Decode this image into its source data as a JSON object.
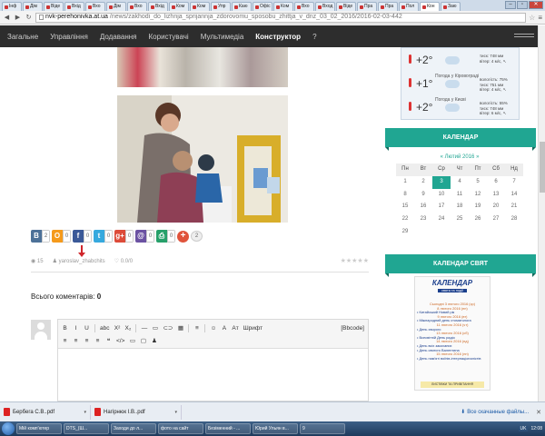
{
  "browser": {
    "tabs": [
      "Інф",
      "Дім",
      "Віде",
      "Вхід",
      "Вхо",
      "Дім",
      "Вхо",
      "Вхід",
      "Ком",
      "Ком",
      "Упр",
      "Каю",
      "Офіс",
      "Ком",
      "Вхо",
      "Вход",
      "Віде",
      "Пра",
      "Пра",
      "Пол",
      "Кон",
      "Заю"
    ],
    "active_tab_index": 20,
    "url_host": "nvk-perehonivka.at.ua",
    "url_path": "/news/zakhodi_do_lizhnja_sprijannja_zdorovomu_sposobu_zhittja_v_dnz_03_02_2016/2016-02-03-442"
  },
  "nav": {
    "items": [
      "Загальне",
      "Управління",
      "Додавання",
      "Користувачі",
      "Мультимедіа",
      "Конструктор",
      "?"
    ],
    "active_index": 5
  },
  "share": {
    "buttons": [
      {
        "icon": "В",
        "count": "2",
        "color": "#4d7198"
      },
      {
        "icon": "O",
        "count": "0",
        "color": "#f59a1b"
      },
      {
        "icon": "f",
        "count": "0",
        "color": "#3b5998"
      },
      {
        "icon": "t",
        "count": "0",
        "color": "#36a9de"
      },
      {
        "icon": "g+",
        "count": "0",
        "color": "#dd4b39"
      },
      {
        "icon": "@",
        "count": "0",
        "color": "#6b52a2"
      },
      {
        "icon": "⎙",
        "count": "0",
        "color": "#27a06a"
      }
    ],
    "plus_count": "2"
  },
  "meta": {
    "views": "15",
    "author": "yaroslav_zhabchits",
    "rating": "0.0/0",
    "stars": "★★★★★"
  },
  "comments": {
    "label": "Всього коментарів: ",
    "count": "0"
  },
  "editor": {
    "row1": [
      "B",
      "I",
      "U",
      "abc",
      "X²",
      "X₂",
      "—",
      "▭",
      "⊂⊃",
      "▦",
      "≡",
      "☺",
      "A",
      "Aᴛ",
      "Шрифт",
      "[Bbcode]"
    ],
    "row2": [
      "≡",
      "≡",
      "≡",
      "≡",
      "❝",
      "</>",
      "▭",
      "▢",
      "♟"
    ]
  },
  "weather": [
    {
      "city": "",
      "temp": "+2°",
      "details": [
        "тиск: 748 мм",
        "вітер: 4 м/с, ↖"
      ]
    },
    {
      "city": "Погода у Кіровограді",
      "temp": "+1°",
      "details": [
        "вологість: 75%",
        "тиск: 751 мм",
        "вітер: 4 м/с, ↖"
      ]
    },
    {
      "city": "Погода у Києві",
      "temp": "+2°",
      "details": [
        "вологість: 55%",
        "тиск: 748 мм",
        "вітер: 6 м/с, ↖"
      ]
    }
  ],
  "calendar": {
    "title": "КАЛЕНДАР",
    "month": "Лютий 2016",
    "prev": "«",
    "next": "»",
    "days": [
      "Пн",
      "Вт",
      "Ср",
      "Чт",
      "Пт",
      "Сб",
      "Нд"
    ],
    "dates": [
      "1",
      "2",
      "3",
      "4",
      "5",
      "6",
      "7",
      "8",
      "9",
      "10",
      "11",
      "12",
      "13",
      "14",
      "15",
      "16",
      "17",
      "18",
      "19",
      "20",
      "21",
      "22",
      "23",
      "24",
      "25",
      "26",
      "27",
      "28",
      "29"
    ],
    "today": "3"
  },
  "holidays": {
    "title": "КАЛЕНДАР СВЯТ",
    "logo_big": "КАЛЕНДАР",
    "logo_small": "свята та події",
    "entries": [
      {
        "date": "Сьогодні 3 лютого 2016 (ср)",
        "name": ""
      },
      {
        "date": "8 лютого 2016 (пн)",
        "name": "• Китайський Новий рік"
      },
      {
        "date": "9 лютого 2016 (вт)",
        "name": "• Міжнародний день стоматолога"
      },
      {
        "date": "11 лютого 2016 (чт)",
        "name": "• День хворого"
      },
      {
        "date": "13 лютого 2016 (сб)",
        "name": "• Всесвітній День радіо"
      },
      {
        "date": "14 лютого 2016 (нд)",
        "name": "• День всіх закоханих"
      },
      {
        "date": "",
        "name": "• День святого Валентина"
      },
      {
        "date": "15 лютого 2016 (пн)",
        "name": "• День пам'яті воїнів-інтернаціоналістів"
      }
    ],
    "footer": "ЛИСТІВКИ ТА ПРИВІТАННЯ"
  },
  "downloads": {
    "items": [
      "Бербега С.В..pdf",
      "Нагірнюк І.В..pdf"
    ],
    "show_all": "Все скачанные файлы..."
  },
  "taskbar": {
    "items": [
      "Мій комп'ютер",
      "DTS_(Ш...",
      "Заходи до л...",
      "фото на сайт",
      "Безіменний - ...",
      "Юрий Ульян в...",
      "9"
    ],
    "lang": "UK",
    "time": "12:08"
  }
}
